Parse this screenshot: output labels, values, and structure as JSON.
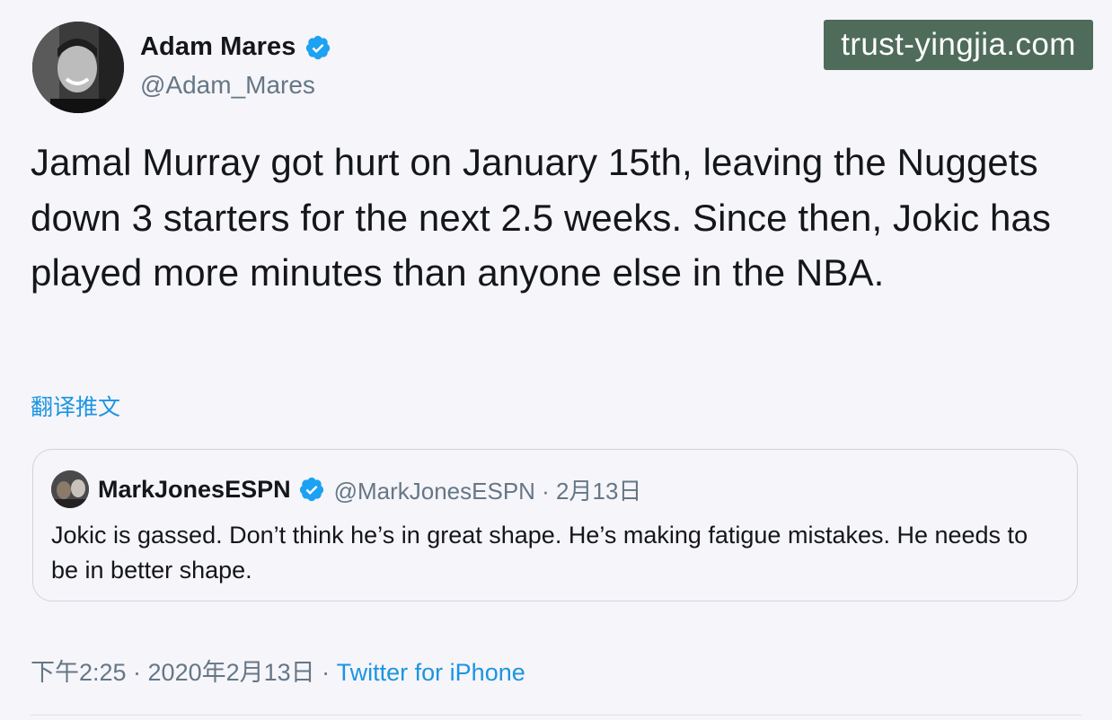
{
  "author": {
    "name": "Adam Mares",
    "handle": "@Adam_Mares",
    "verified": true,
    "avatar_icon": "profile-photo"
  },
  "watermark": "trust-yingjia.com",
  "tweet": {
    "text": "Jamal Murray got hurt on January 15th, leaving the Nuggets down 3 starters for the next 2.5 weeks. Since then, Jokic has played more minutes than anyone else in the NBA.",
    "translate_label": "翻译推文"
  },
  "quoted": {
    "name": "MarkJonesESPN",
    "verified": true,
    "meta": "@MarkJonesESPN · 2月13日",
    "text": "Jokic is gassed. Don’t think he’s in great shape. He’s making fatigue mistakes. He needs to be in better shape."
  },
  "footer": {
    "timestamp": "下午2:25 · 2020年2月13日 · ",
    "source": "Twitter for iPhone"
  },
  "colors": {
    "accent": "#1b95e0",
    "secondary_text": "#657786",
    "verified_badge": "#1da1f2",
    "background": "#f6f5fa"
  }
}
